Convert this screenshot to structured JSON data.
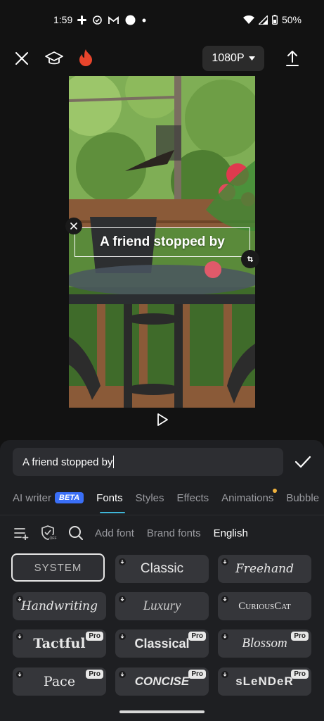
{
  "status_bar": {
    "time": "1:59",
    "battery": "50%",
    "left_icons": [
      "slack-icon",
      "check-circle-icon",
      "gmail-icon",
      "circle-icon",
      "dot-icon"
    ],
    "right_icons": [
      "wifi-icon",
      "signal-icon",
      "battery-icon"
    ]
  },
  "top_bar": {
    "resolution": "1080P",
    "icons": [
      "close-icon",
      "graduation-cap-icon",
      "fire-icon",
      "export-icon"
    ]
  },
  "preview": {
    "overlay_text": "A friend stopped by"
  },
  "editor": {
    "input_value": "A friend stopped by",
    "confirm_icon": "check-icon"
  },
  "tabs": [
    {
      "label": "AI writer",
      "badge": "BETA"
    },
    {
      "label": "Fonts",
      "active": true
    },
    {
      "label": "Styles"
    },
    {
      "label": "Effects"
    },
    {
      "label": "Animations",
      "dot": true
    },
    {
      "label": "Bubble"
    }
  ],
  "font_toolbar": {
    "add_font": "Add font",
    "brand_fonts": "Brand fonts",
    "language": "English"
  },
  "fonts": [
    {
      "name": "SYSTEM",
      "selected": true
    },
    {
      "name": "Classic",
      "download": true
    },
    {
      "name": "Freehand",
      "download": true
    },
    {
      "name": "Handwriting",
      "download": true
    },
    {
      "name": "Luxury",
      "download": true
    },
    {
      "name": "CuriousCat",
      "download": true
    },
    {
      "name": "Tactful",
      "download": true,
      "pro": "Pro"
    },
    {
      "name": "Classical",
      "download": true,
      "pro": "Pro"
    },
    {
      "name": "Blossom",
      "download": true,
      "pro": "Pro"
    },
    {
      "name": "Pace",
      "download": true,
      "pro": "Pro"
    },
    {
      "name": "CONCISE",
      "download": true,
      "pro": "Pro"
    },
    {
      "name": "sLeNDeR",
      "download": true,
      "pro": "Pro"
    }
  ],
  "colors": {
    "accent": "#3fb6d8",
    "beta_badge": "#3a6ff7",
    "notification_dot": "#f2b33d",
    "fire": "#e8452c"
  }
}
